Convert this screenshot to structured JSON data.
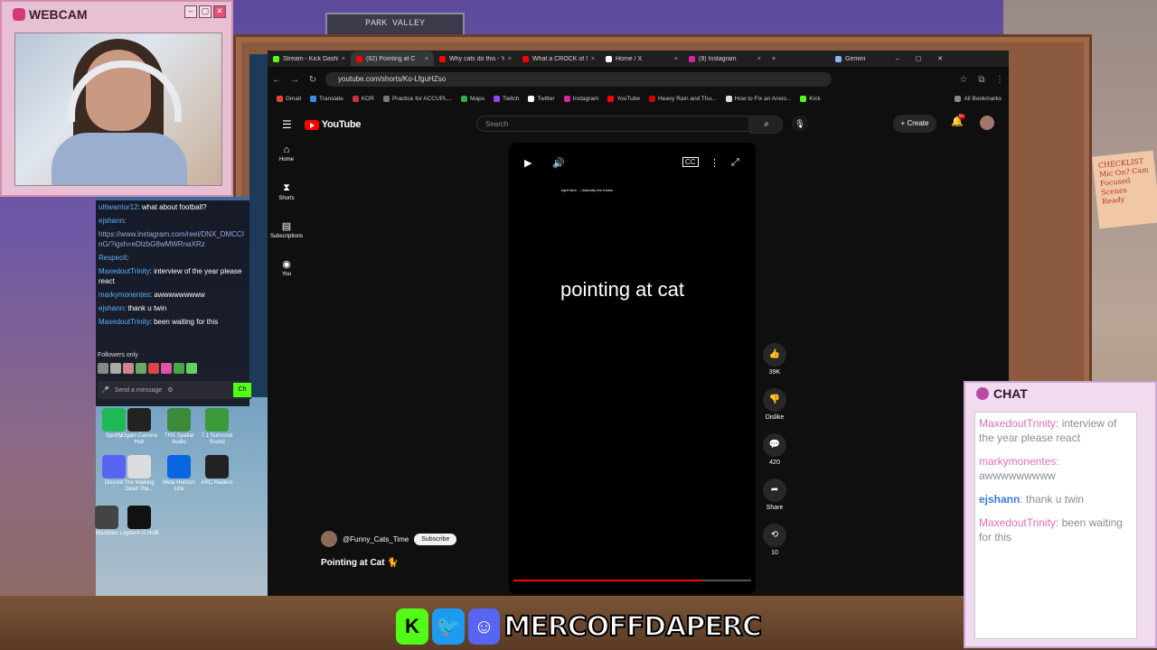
{
  "webcam": {
    "title": "WEBCAM"
  },
  "room": {
    "banner": "PARK VALLEY",
    "sticky_note": "CHECKLIST Mic On? Cam Focused Scenes Ready"
  },
  "kick_chat": {
    "lines": [
      {
        "user": "ultiwarrior12",
        "text": ": what about football?"
      },
      {
        "user": "ejshann",
        "text": ":"
      },
      {
        "user": "",
        "text": "https://www.instagram.com/reel/DNX_DMCCI"
      },
      {
        "user": "",
        "text": "nG/?igsh=eDlzbG8wMWRnaXRz"
      },
      {
        "user": "Respecit",
        "text": ":"
      },
      {
        "user": "MaxedoutTrinity",
        "text": ": interview of the year please react"
      },
      {
        "user": "markymonentes",
        "text": ": awwwwwwwww"
      },
      {
        "user": "ejshann",
        "text": ": thank u twin"
      },
      {
        "user": "MaxedoutTrinity",
        "text": ": been waiting for this"
      }
    ],
    "followers_only": "Followers only",
    "send_placeholder": "Send a message",
    "chat_button": "Ch"
  },
  "desktop_icons": [
    {
      "label": "Spotify"
    },
    {
      "label": "Elgato Camera Hub"
    },
    {
      "label": "THX Spatial Audio"
    },
    {
      "label": "7.1 Surround Sound"
    },
    {
      "label": "Discord"
    },
    {
      "label": "The Walking Dead The..."
    },
    {
      "label": "Meta Horizon Link"
    },
    {
      "label": "ARC Raiders"
    },
    {
      "label": "Blackbox"
    },
    {
      "label": "Logitech G HUB"
    }
  ],
  "browser": {
    "tabs": [
      {
        "label": "Stream - Kick Dashb",
        "color": "#53fc18"
      },
      {
        "label": "(62) Pointing at C",
        "color": "#ff0000"
      },
      {
        "label": "Why cats do this - Yo",
        "color": "#ff0000"
      },
      {
        "label": "What a CROCK of S",
        "color": "#ff0000"
      },
      {
        "label": "Home / X",
        "color": "#ffffff"
      },
      {
        "label": "(9) Instagram",
        "color": "#d6249f"
      },
      {
        "label": "Gemini",
        "color": "#8ab4f8"
      }
    ],
    "url": "youtube.com/shorts/Ko-LfguHZso",
    "bookmarks": [
      "Gmail",
      "Translate",
      "KOR",
      "Practice for ACCUPL...",
      "Maps",
      "Twitch",
      "Twitter",
      "Instagram",
      "YouTube",
      "Heavy Rain and Thu...",
      "How to Fix an Anxio...",
      "Kick"
    ],
    "all_bookmarks": "All Bookmarks"
  },
  "youtube": {
    "logo": "YouTube",
    "search_placeholder": "Search",
    "create_label": "Create",
    "notif_count": "9+",
    "sidebar": [
      {
        "icon": "home-icon",
        "label": "Home"
      },
      {
        "icon": "shorts-icon",
        "label": "Shorts"
      },
      {
        "icon": "subscriptions-icon",
        "label": "Subscriptions"
      },
      {
        "icon": "you-icon",
        "label": "You"
      }
    ],
    "video_caption": "pointing at cat",
    "video_small_text": "right here. -- basically the rubber",
    "actions": [
      {
        "icon": "like-icon",
        "label": "39K"
      },
      {
        "icon": "dislike-icon",
        "label": "Dislike"
      },
      {
        "icon": "comment-icon",
        "label": "420"
      },
      {
        "icon": "share-icon",
        "label": "Share"
      },
      {
        "icon": "remix-icon",
        "label": "10"
      }
    ],
    "channel": "@Funny_Cats_Time",
    "subscribe": "Subscribe",
    "title": "Pointing at Cat 🐈",
    "progress": 0.79
  },
  "stream_chat": {
    "title": "CHAT",
    "messages": [
      {
        "user": "MaxedoutTrinity",
        "text": ": interview of the year  please react"
      },
      {
        "user": "markymonentes",
        "text": ": awwwwwwwww"
      },
      {
        "user": "ejshann",
        "text": ": thank u twin"
      },
      {
        "user": "MaxedoutTrinity",
        "text": ": been waiting for this"
      }
    ]
  },
  "social_banner": {
    "handle": "MERCOFFDAPERC"
  }
}
